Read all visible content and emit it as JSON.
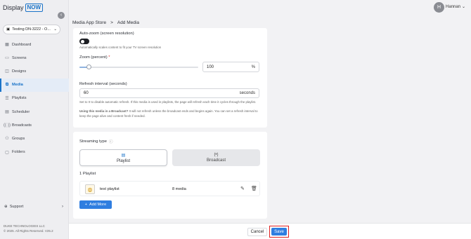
{
  "brand": {
    "logo_text": "Display",
    "logo_box": "NOW"
  },
  "workspace": {
    "label": "Testing DN-3222 - O...",
    "icon": "screen-icon"
  },
  "sidebar": {
    "items": [
      {
        "label": "Dashboard",
        "icon": "dashboard-icon"
      },
      {
        "label": "Screens",
        "icon": "screen-icon"
      },
      {
        "label": "Designs",
        "icon": "design-icon"
      },
      {
        "label": "Media",
        "icon": "media-icon",
        "active": true
      },
      {
        "label": "Playlists",
        "icon": "playlist-icon"
      },
      {
        "label": "Scheduler",
        "icon": "calendar-icon"
      },
      {
        "label": "Broadcasts",
        "icon": "broadcast-icon"
      },
      {
        "label": "Groups",
        "icon": "groups-icon"
      },
      {
        "label": "Folders",
        "icon": "folder-icon"
      }
    ],
    "support": "Support",
    "company": "DUKE TECHNOLOGIES LLC",
    "copyright": "© 2025. All Rights Reserved. V25.2"
  },
  "user": {
    "initial": "H",
    "name": "Hannan"
  },
  "breadcrumb": {
    "parent": "Media App Store",
    "separator": ">",
    "current": "Add Media"
  },
  "settings": {
    "autozoom_label": "Auto-zoom (screen resolution)",
    "autozoom_hint": "Automatically scales content to fit your TV screen resolution",
    "autozoom_on": false,
    "zoom_label": "Zoom (percent)",
    "zoom_required": "*",
    "zoom_value": "100",
    "zoom_unit": "%",
    "zoom_slider_fraction": 0.08,
    "refresh_label": "Refresh interval (seconds)",
    "refresh_value": "60",
    "refresh_unit": "seconds",
    "refresh_hint": "Set to 0 to disable automatic refresh. If this media is used in playlists, the page will refresh each time it cycles through the playlist.",
    "broadcast_hint_bold": "Using this media in a Broadcast?",
    "broadcast_hint": " It will not refresh unless the broadcast ends and begins again. You can set a refresh interval to keep the page alive and content fresh if needed."
  },
  "streaming": {
    "label": "Streaming type",
    "options": [
      {
        "label": "Playlist",
        "icon": "playlist-icon",
        "selected": true
      },
      {
        "label": "Broadcast",
        "icon": "broadcast-icon",
        "selected": false
      }
    ],
    "count_label": "1 Playlist",
    "playlists": [
      {
        "name": "test playlist",
        "count": "8 media"
      }
    ],
    "add_more": "Add More"
  },
  "actions": {
    "cancel": "Cancel",
    "save": "Save"
  },
  "colors": {
    "accent": "#2f7ee0",
    "highlight": "#e02020"
  }
}
